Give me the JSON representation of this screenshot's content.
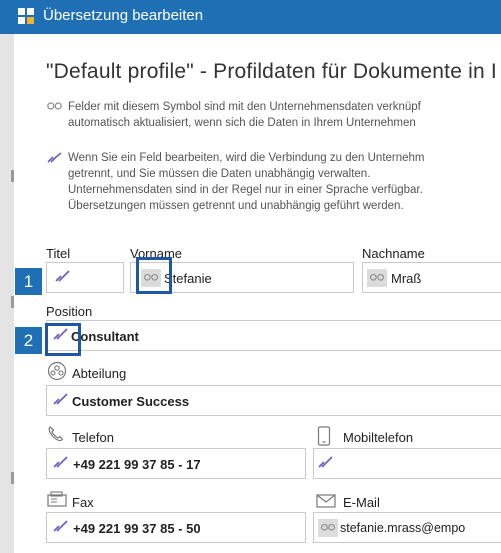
{
  "window": {
    "title": "Übersetzung bearbeiten"
  },
  "heading": "\"Default profile\" - Profildaten für Dokumente in I",
  "info_linked": {
    "line1": "Felder mit diesem Symbol sind mit den Unternehmensdaten verknüpf",
    "line2": "automatisch aktualisiert, wenn sich die Daten in Ihrem Unternehmen"
  },
  "info_unlinked": {
    "line1": "Wenn Sie ein Feld bearbeiten, wird die Verbindung zu den Unternehm",
    "line2": "getrennt, und Sie müssen die Daten unabhängig verwalten.",
    "line3": "Unternehmensdaten sind in der Regel nur in einer Sprache verfügbar.",
    "line4": "Übersetzungen müssen getrennt und unabhängig geführt werden."
  },
  "fields": {
    "titel": {
      "label": "Titel",
      "value": ""
    },
    "vorname": {
      "label": "Vorname",
      "value": "Stefanie"
    },
    "nachname": {
      "label": "Nachname",
      "value": "Mraß"
    },
    "position": {
      "label": "Position",
      "value": "Consultant"
    },
    "abteilung": {
      "label": "Abteilung",
      "value": "Customer Success"
    },
    "telefon": {
      "label": "Telefon",
      "value": "+49 221 99 37 85 - 17"
    },
    "mobiltelefon": {
      "label": "Mobiltelefon",
      "value": ""
    },
    "fax": {
      "label": "Fax",
      "value": "+49 221 99 37 85 - 50"
    },
    "email": {
      "label": "E-Mail",
      "value": "stefanie.mrass@empo"
    }
  },
  "callouts": [
    "1",
    "2"
  ],
  "icons": {
    "linked": "link-icon",
    "unlinked": "broken-link-icon",
    "department": "department-icon",
    "phone": "phone-icon",
    "mobile": "mobile-icon",
    "fax": "fax-icon",
    "email": "envelope-icon"
  },
  "colors": {
    "accent": "#1f6fb5",
    "unlinked_icon": "#6b5cc4",
    "highlight": "#1f56a5"
  }
}
